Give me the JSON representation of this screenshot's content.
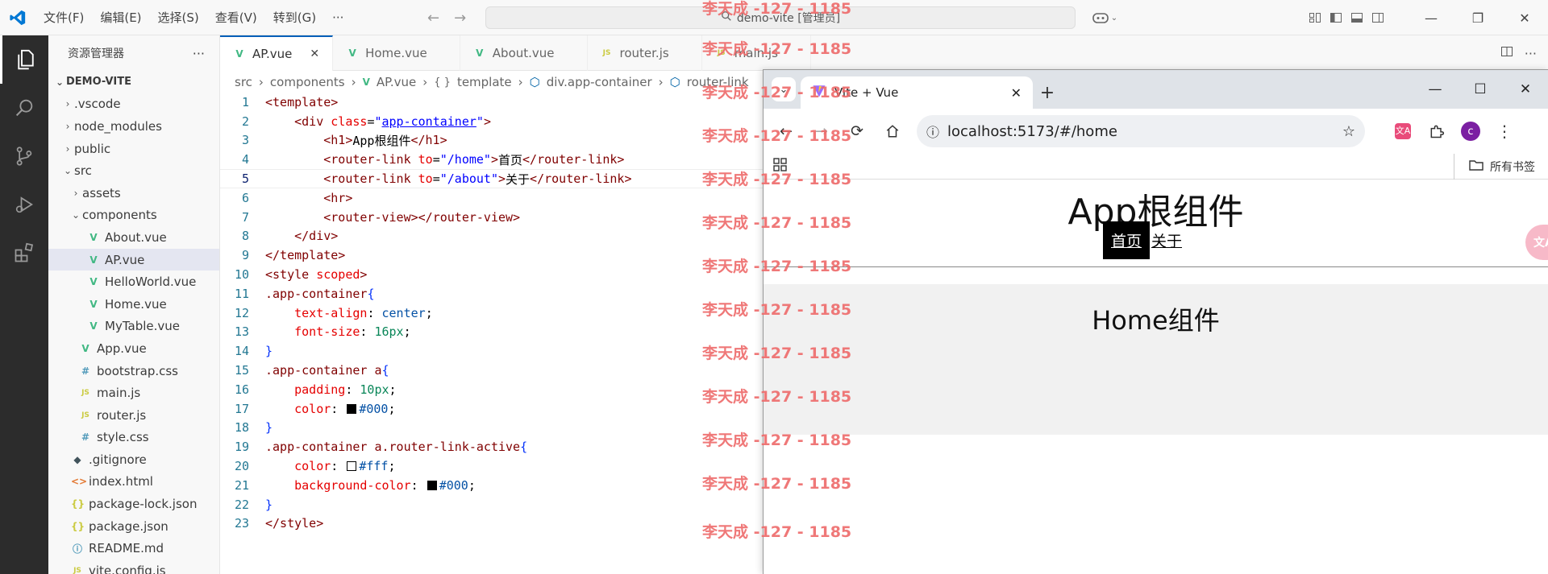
{
  "titlebar": {
    "menus": [
      "文件(F)",
      "编辑(E)",
      "选择(S)",
      "查看(V)",
      "转到(G)",
      "···"
    ],
    "command_center": "demo-vite [管理员]"
  },
  "sidebar": {
    "title": "资源管理器",
    "root": "DEMO-VITE",
    "items": [
      {
        "label": ".vscode",
        "indent": 1,
        "kind": "folder",
        "open": false
      },
      {
        "label": "node_modules",
        "indent": 1,
        "kind": "folder",
        "open": false
      },
      {
        "label": "public",
        "indent": 1,
        "kind": "folder",
        "open": false
      },
      {
        "label": "src",
        "indent": 1,
        "kind": "folder",
        "open": true
      },
      {
        "label": "assets",
        "indent": 2,
        "kind": "folder",
        "open": false
      },
      {
        "label": "components",
        "indent": 2,
        "kind": "folder",
        "open": true
      },
      {
        "label": "About.vue",
        "indent": 3,
        "kind": "vue"
      },
      {
        "label": "AP.vue",
        "indent": 3,
        "kind": "vue",
        "selected": true
      },
      {
        "label": "HelloWorld.vue",
        "indent": 3,
        "kind": "vue"
      },
      {
        "label": "Home.vue",
        "indent": 3,
        "kind": "vue"
      },
      {
        "label": "MyTable.vue",
        "indent": 3,
        "kind": "vue"
      },
      {
        "label": "App.vue",
        "indent": 2,
        "kind": "vue"
      },
      {
        "label": "bootstrap.css",
        "indent": 2,
        "kind": "css"
      },
      {
        "label": "main.js",
        "indent": 2,
        "kind": "js"
      },
      {
        "label": "router.js",
        "indent": 2,
        "kind": "js"
      },
      {
        "label": "style.css",
        "indent": 2,
        "kind": "css"
      },
      {
        "label": ".gitignore",
        "indent": 1,
        "kind": "git"
      },
      {
        "label": "index.html",
        "indent": 1,
        "kind": "html"
      },
      {
        "label": "package-lock.json",
        "indent": 1,
        "kind": "json"
      },
      {
        "label": "package.json",
        "indent": 1,
        "kind": "json"
      },
      {
        "label": "README.md",
        "indent": 1,
        "kind": "info"
      },
      {
        "label": "vite.config.js",
        "indent": 1,
        "kind": "js"
      }
    ]
  },
  "icons": {
    "vue": "V",
    "js": "JS",
    "css": "#",
    "html": "<>",
    "json": "{}",
    "git": "◆",
    "info": "ⓘ"
  },
  "tabs": [
    {
      "label": "AP.vue",
      "kind": "vue",
      "active": true
    },
    {
      "label": "Home.vue",
      "kind": "vue"
    },
    {
      "label": "About.vue",
      "kind": "vue"
    },
    {
      "label": "router.js",
      "kind": "js"
    },
    {
      "label": "main.js",
      "kind": "js"
    }
  ],
  "breadcrumb": [
    "src",
    "components",
    "AP.vue",
    "template",
    "div.app-container",
    "router-link"
  ],
  "code": {
    "current_line": 5,
    "lines": [
      [
        [
          "tag",
          "<template>"
        ]
      ],
      [
        [
          "tag",
          "    <div "
        ],
        [
          "attr",
          "class"
        ],
        [
          "txt",
          "="
        ],
        [
          "str",
          "\""
        ],
        [
          "strlink",
          "app-container"
        ],
        [
          "str",
          "\""
        ],
        [
          "tag",
          ">"
        ]
      ],
      [
        [
          "tag",
          "        <h1>"
        ],
        [
          "txt",
          "App根组件"
        ],
        [
          "tag",
          "</h1>"
        ]
      ],
      [
        [
          "tag",
          "        <router-link "
        ],
        [
          "attr",
          "to"
        ],
        [
          "txt",
          "="
        ],
        [
          "str",
          "\"/home\""
        ],
        [
          "tag",
          ">"
        ],
        [
          "txt",
          "首页"
        ],
        [
          "tag",
          "</router-link>"
        ]
      ],
      [
        [
          "tag",
          "        <router-link "
        ],
        [
          "attr",
          "to"
        ],
        [
          "txt",
          "="
        ],
        [
          "str",
          "\"/about\""
        ],
        [
          "tag",
          ">"
        ],
        [
          "txt",
          "关于"
        ],
        [
          "tag",
          "</router-link>"
        ]
      ],
      [
        [
          "tag",
          "        <hr>"
        ]
      ],
      [
        [
          "tag",
          "        <router-view></router-view>"
        ]
      ],
      [
        [
          "tag",
          "    </div>"
        ]
      ],
      [
        [
          "tag",
          "</template>"
        ]
      ],
      [
        [
          "tag",
          "<style "
        ],
        [
          "attr",
          "scoped"
        ],
        [
          "tag",
          ">"
        ]
      ],
      [
        [
          "sel",
          ".app-container"
        ],
        [
          "br",
          "{"
        ]
      ],
      [
        [
          "txt",
          "    "
        ],
        [
          "prop",
          "text-align"
        ],
        [
          "txt",
          ": "
        ],
        [
          "val",
          "center"
        ],
        [
          "txt",
          ";"
        ]
      ],
      [
        [
          "txt",
          "    "
        ],
        [
          "prop",
          "font-size"
        ],
        [
          "txt",
          ": "
        ],
        [
          "num",
          "16px"
        ],
        [
          "txt",
          ";"
        ]
      ],
      [
        [
          "br",
          "}"
        ]
      ],
      [
        [
          "sel",
          ".app-container a"
        ],
        [
          "br",
          "{"
        ]
      ],
      [
        [
          "txt",
          "    "
        ],
        [
          "prop",
          "padding"
        ],
        [
          "txt",
          ": "
        ],
        [
          "num",
          "10px"
        ],
        [
          "txt",
          ";"
        ]
      ],
      [
        [
          "txt",
          "    "
        ],
        [
          "prop",
          "color"
        ],
        [
          "txt",
          ": "
        ],
        [
          "swatch",
          "#000000"
        ],
        [
          "val",
          "#000"
        ],
        [
          "txt",
          ";"
        ]
      ],
      [
        [
          "br",
          "}"
        ]
      ],
      [
        [
          "sel",
          ".app-container a.router-link-active"
        ],
        [
          "br",
          "{"
        ]
      ],
      [
        [
          "txt",
          "    "
        ],
        [
          "prop",
          "color"
        ],
        [
          "txt",
          ": "
        ],
        [
          "swatch",
          "#ffffff"
        ],
        [
          "val",
          "#fff"
        ],
        [
          "txt",
          ";"
        ]
      ],
      [
        [
          "txt",
          "    "
        ],
        [
          "prop",
          "background-color"
        ],
        [
          "txt",
          ": "
        ],
        [
          "swatch",
          "#000000"
        ],
        [
          "val",
          "#000"
        ],
        [
          "txt",
          ";"
        ]
      ],
      [
        [
          "br",
          "}"
        ]
      ],
      [
        [
          "tag",
          "</style>"
        ]
      ]
    ]
  },
  "watermark": "李天成 -127 - 1185",
  "browser": {
    "tab_title": "Vite + Vue",
    "url": "localhost:5173/#/home",
    "bookmarks_label": "所有书签",
    "avatar_letter": "c",
    "translate_label": "文A",
    "page": {
      "h1": "App根组件",
      "link_home": "首页",
      "link_about": "关于",
      "view_title": "Home组件"
    }
  }
}
